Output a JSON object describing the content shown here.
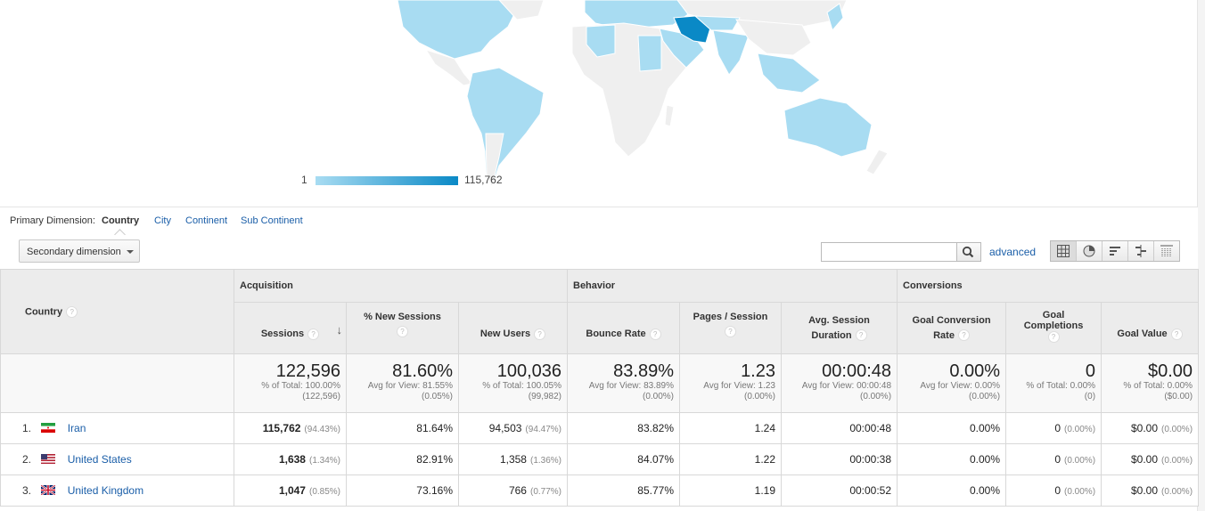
{
  "map": {
    "legend_min": "1",
    "legend_max": "115,762",
    "highlight_color": "#0a89c6",
    "low_color": "#a8dcf2",
    "no_data_color": "#efefef"
  },
  "primary_dimension": {
    "label": "Primary Dimension:",
    "active": "Country",
    "options": [
      "City",
      "Continent",
      "Sub Continent"
    ]
  },
  "toolbar": {
    "secondary_dimension": "Secondary dimension",
    "search_placeholder": "",
    "advanced": "advanced",
    "view_icons": [
      "table-view-icon",
      "pie-view-icon",
      "performance-view-icon",
      "comparison-view-icon",
      "pivot-view-icon"
    ]
  },
  "table": {
    "country_header": "Country",
    "groups": [
      "Acquisition",
      "Behavior",
      "Conversions"
    ],
    "columns": [
      {
        "line1": "Sessions",
        "line2": ""
      },
      {
        "line1": "% New Sessions",
        "line2": ""
      },
      {
        "line1": "New Users",
        "line2": ""
      },
      {
        "line1": "Bounce Rate",
        "line2": ""
      },
      {
        "line1": "Pages / Session",
        "line2": ""
      },
      {
        "line1": "Avg. Session",
        "line2": "Duration"
      },
      {
        "line1": "Goal Conversion",
        "line2": "Rate"
      },
      {
        "line1": "Goal",
        "line2": "Completions"
      },
      {
        "line1": "Goal Value",
        "line2": ""
      }
    ],
    "totals": [
      {
        "value": "122,596",
        "sub1": "% of Total: 100.00%",
        "sub2": "(122,596)"
      },
      {
        "value": "81.60%",
        "sub1": "Avg for View: 81.55%",
        "sub2": "(0.05%)"
      },
      {
        "value": "100,036",
        "sub1": "% of Total: 100.05%",
        "sub2": "(99,982)"
      },
      {
        "value": "83.89%",
        "sub1": "Avg for View: 83.89%",
        "sub2": "(0.00%)"
      },
      {
        "value": "1.23",
        "sub1": "Avg for View: 1.23",
        "sub2": "(0.00%)"
      },
      {
        "value": "00:00:48",
        "sub1": "Avg for View: 00:00:48",
        "sub2": "(0.00%)"
      },
      {
        "value": "0.00%",
        "sub1": "Avg for View: 0.00%",
        "sub2": "(0.00%)"
      },
      {
        "value": "0",
        "sub1": "% of Total: 0.00%",
        "sub2": "(0)"
      },
      {
        "value": "$0.00",
        "sub1": "% of Total: 0.00%",
        "sub2": "($0.00)"
      }
    ],
    "rows": [
      {
        "rank": "1.",
        "country": "Iran",
        "flag": "iran-flag-icon",
        "sessions": "115,762",
        "sessions_pct": "(94.43%)",
        "new_sessions": "81.64%",
        "new_users": "94,503",
        "new_users_pct": "(94.47%)",
        "bounce": "83.82%",
        "pages": "1.24",
        "duration": "00:00:48",
        "conv_rate": "0.00%",
        "completions": "0",
        "completions_pct": "(0.00%)",
        "value": "$0.00",
        "value_pct": "(0.00%)"
      },
      {
        "rank": "2.",
        "country": "United States",
        "flag": "usa-flag-icon",
        "sessions": "1,638",
        "sessions_pct": "(1.34%)",
        "new_sessions": "82.91%",
        "new_users": "1,358",
        "new_users_pct": "(1.36%)",
        "bounce": "84.07%",
        "pages": "1.22",
        "duration": "00:00:38",
        "conv_rate": "0.00%",
        "completions": "0",
        "completions_pct": "(0.00%)",
        "value": "$0.00",
        "value_pct": "(0.00%)"
      },
      {
        "rank": "3.",
        "country": "United Kingdom",
        "flag": "uk-flag-icon",
        "sessions": "1,047",
        "sessions_pct": "(0.85%)",
        "new_sessions": "73.16%",
        "new_users": "766",
        "new_users_pct": "(0.77%)",
        "bounce": "85.77%",
        "pages": "1.19",
        "duration": "00:00:52",
        "conv_rate": "0.00%",
        "completions": "0",
        "completions_pct": "(0.00%)",
        "value": "$0.00",
        "value_pct": "(0.00%)"
      }
    ]
  }
}
